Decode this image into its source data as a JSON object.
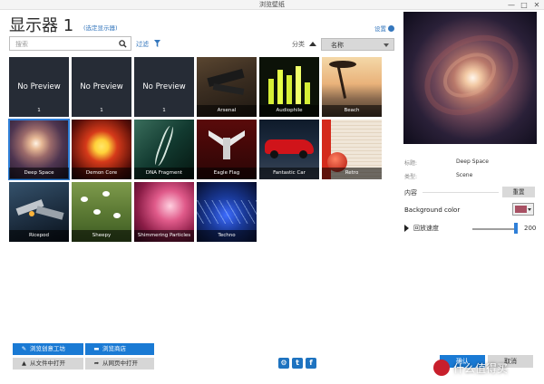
{
  "window": {
    "title": "浏览壁纸",
    "minimize": "—",
    "maximize": "□",
    "close": "✕"
  },
  "header": {
    "monitor_title": "显示器 1",
    "select_monitor": "(选定显示器)",
    "settings": "设置"
  },
  "toolbar": {
    "search_placeholder": "搜索",
    "filter": "过滤",
    "sort_label": "分类",
    "sort_value": "名称"
  },
  "wallpapers": [
    {
      "label": "1",
      "preview": "No Preview"
    },
    {
      "label": "1",
      "preview": "No Preview"
    },
    {
      "label": "1",
      "preview": "No Preview"
    },
    {
      "label": "Arsenal"
    },
    {
      "label": "Audiophile"
    },
    {
      "label": "Beach"
    },
    {
      "label": "Deep Space",
      "selected": true
    },
    {
      "label": "Demon Core"
    },
    {
      "label": "DNA Fragment"
    },
    {
      "label": "Eagle Flag"
    },
    {
      "label": "Fantastic Car"
    },
    {
      "label": "Retro"
    },
    {
      "label": "Ricepod"
    },
    {
      "label": "Sheepy"
    },
    {
      "label": "Shimmering Particles"
    },
    {
      "label": "Techno"
    }
  ],
  "details": {
    "title_label": "标题:",
    "title_value": "Deep Space",
    "type_label": "类型:",
    "type_value": "Scene",
    "content_label": "内容",
    "reset_button": "重置",
    "bg_color_label": "Background color",
    "bg_color_value": "#a85063",
    "speed_label": "回放速度",
    "speed_value": "200",
    "speed_fraction": 0.95
  },
  "bottom": {
    "workshop": "浏览创意工坊",
    "shop": "浏览商店",
    "open_file": "从文件中打开",
    "open_web": "从网页中打开",
    "ok": "确认",
    "cancel": "取消",
    "watermark": "什么值得买"
  },
  "colors": {
    "accent": "#1a7ad4",
    "link": "#3577bd"
  }
}
